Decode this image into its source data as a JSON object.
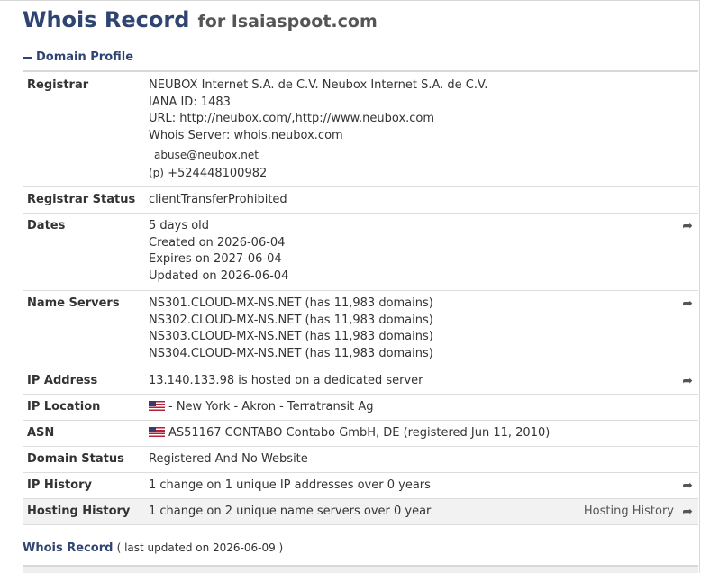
{
  "header": {
    "title": "Whois Record",
    "subtitle": "for Isaiaspoot.com"
  },
  "section": {
    "label": "Domain Profile"
  },
  "rows": {
    "registrar": {
      "label": "Registrar",
      "lines": [
        "NEUBOX Internet S.A. de C.V. Neubox Internet S.A. de C.V.",
        "IANA ID: 1483",
        "URL: http://neubox.com/,http://www.neubox.com",
        "Whois Server: whois.neubox.com"
      ],
      "email": "abuse@neubox.net",
      "phone_prefix": "(p)",
      "phone": "+524448100982"
    },
    "registrar_status": {
      "label": "Registrar Status",
      "value": "clientTransferProhibited"
    },
    "dates": {
      "label": "Dates",
      "lines": [
        "5 days old",
        "Created on 2026-06-04",
        "Expires on 2027-06-04",
        "Updated on 2026-06-04"
      ]
    },
    "name_servers": {
      "label": "Name Servers",
      "lines": [
        "NS301.CLOUD-MX-NS.NET (has 11,983 domains)",
        "NS302.CLOUD-MX-NS.NET (has 11,983 domains)",
        "NS303.CLOUD-MX-NS.NET (has 11,983 domains)",
        "NS304.CLOUD-MX-NS.NET (has 11,983 domains)"
      ]
    },
    "ip_address": {
      "label": "IP Address",
      "value": "13.140.133.98 is hosted on a dedicated server"
    },
    "ip_location": {
      "label": "IP Location",
      "value": "- New York - Akron - Terratransit Ag"
    },
    "asn": {
      "label": "ASN",
      "value": "AS51167 CONTABO Contabo GmbH, DE (registered Jun 11, 2010)"
    },
    "domain_status": {
      "label": "Domain Status",
      "value": "Registered And No Website"
    },
    "ip_history": {
      "label": "IP History",
      "value": "1 change on 1 unique IP addresses over 0 years"
    },
    "hosting_history": {
      "label": "Hosting History",
      "value": "1 change on 2 unique name servers over 0 year",
      "link": "Hosting History"
    }
  },
  "footer": {
    "title": "Whois Record",
    "updated": "( last updated on 2026-06-09 )"
  },
  "icons": {
    "share": "share-arrow-icon",
    "collapse": "minus-icon",
    "flag": "us-flag-icon"
  },
  "colors": {
    "heading": "#2f4470",
    "text": "#333333",
    "alt_row": "#f2f2f2"
  }
}
